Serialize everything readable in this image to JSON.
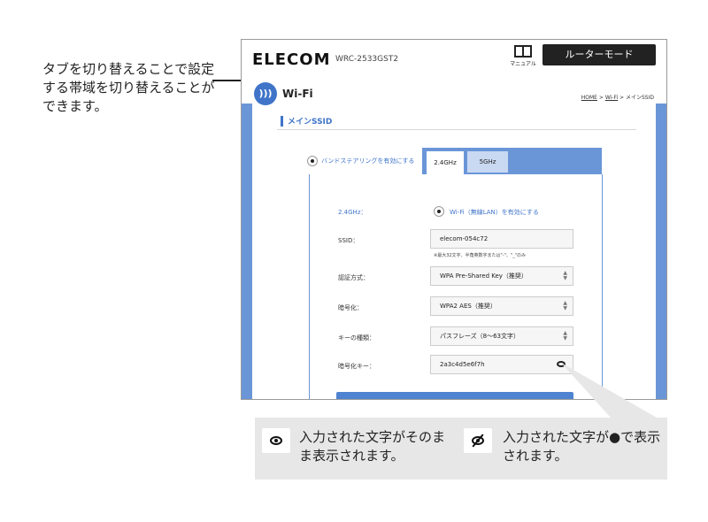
{
  "callout": {
    "left_text": "タブを切り替えることで設定する帯域を切り替えることができます。"
  },
  "screen": {
    "logo": "ELECOM",
    "model": "WRC-2533GST2",
    "manual_label": "マニュアル",
    "mode_button": "ルーターモード",
    "page_title": "Wi-Fi",
    "breadcrumb_home": "HOME",
    "breadcrumb_sep1": " > ",
    "breadcrumb_wifi": "Wi-Fi",
    "breadcrumb_sep2": " > ",
    "breadcrumb_current": "メインSSID",
    "section_title": "メインSSID",
    "band_steering_label": "バンドステアリングを有効にする",
    "tabs": [
      {
        "label": "2.4GHz"
      },
      {
        "label": "5GHz"
      }
    ],
    "band_label": "2.4GHz：",
    "enable_label": "Wi-Fi（無線LAN）を有効にする",
    "ssid_label": "SSID：",
    "ssid_value": "elecom-054c72",
    "ssid_hint": "※最大32文字、半角英数字または\"-\"、\"_\"のみ",
    "auth_label": "認証方式：",
    "auth_value": "WPA Pre-Shared Key（推奨）",
    "enc_label": "暗号化：",
    "enc_value": "WPA2 AES（推奨）",
    "keytype_label": "キーの種類：",
    "keytype_value": "パスフレーズ（8〜63文字）",
    "key_label": "暗号化キー：",
    "key_value": "2a3c4d5e6f7h"
  },
  "legend": {
    "shown_text": "入力された文字がそのまま表示されます。",
    "hidden_text": "入力された文字が●で表示されます。"
  },
  "icons": {
    "eye": "eye-icon",
    "eye_off": "eye-off-icon",
    "wifi": "wifi-icon",
    "manual": "book-icon"
  },
  "colors": {
    "accent": "#3f74c9",
    "frame_blue": "#6a96d8",
    "legend_bg": "#e7e7e7",
    "mode_button": "#222222"
  }
}
